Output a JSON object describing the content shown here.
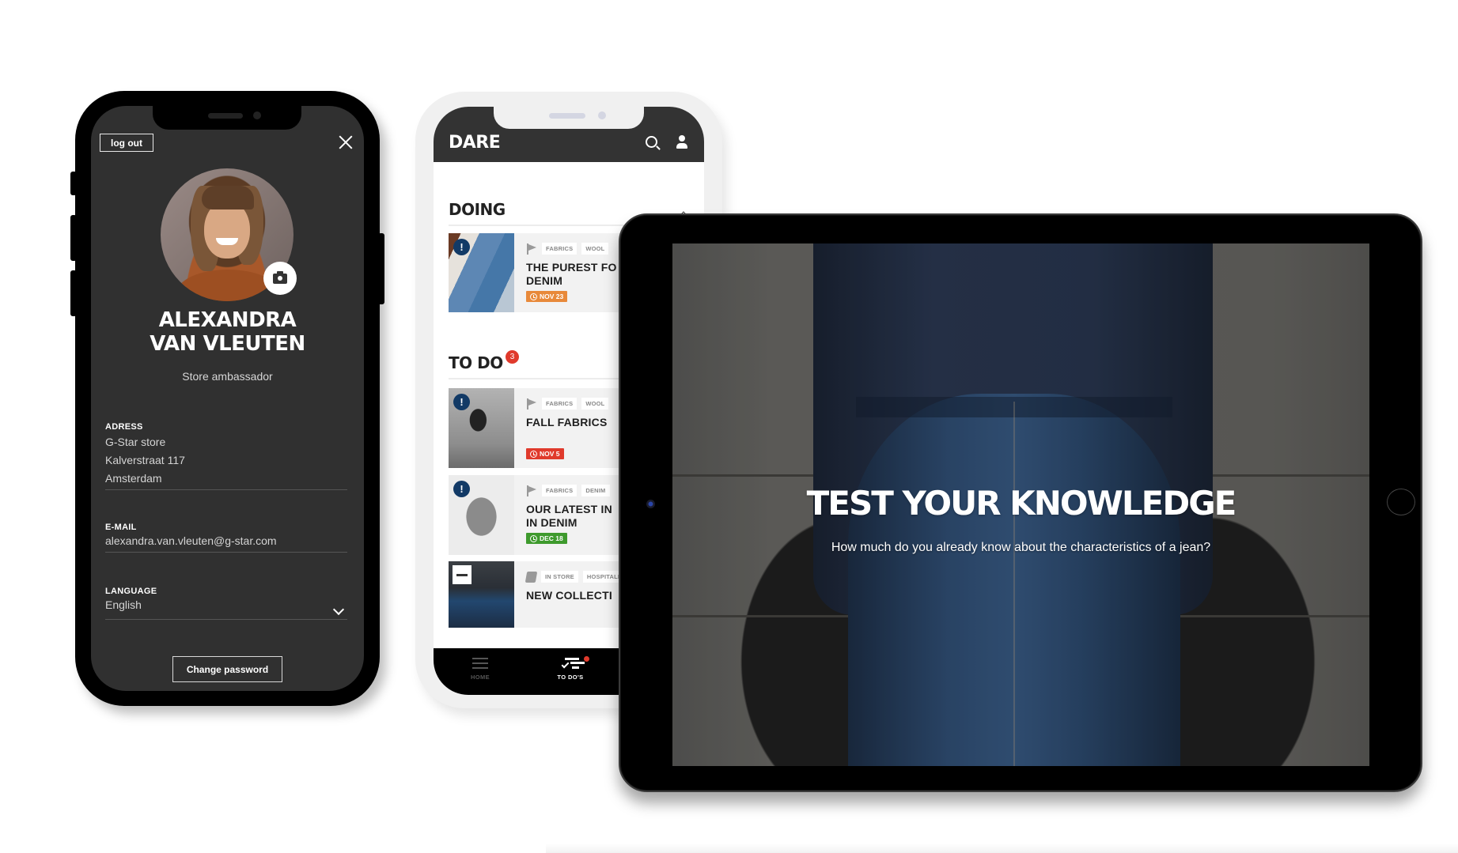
{
  "profile_phone": {
    "logout_label": "log out",
    "name_line1": "ALEXANDRA",
    "name_line2": "VAN VLEUTEN",
    "role": "Store ambassador",
    "fields": {
      "address": {
        "label": "ADRESS",
        "lines": [
          "G-Star store",
          "Kalverstraat 117",
          "Amsterdam"
        ]
      },
      "email": {
        "label": "E-MAIL",
        "value": "alexandra.van.vleuten@g-star.com"
      },
      "language": {
        "label": "LANGUAGE",
        "value": "English"
      }
    },
    "change_password_label": "Change password"
  },
  "todo_phone": {
    "app_name": "DARE",
    "sections": {
      "doing": {
        "title": "DOING"
      },
      "todo": {
        "title": "TO DO",
        "count": "3"
      }
    },
    "cards": [
      {
        "tags": [
          "FABRICS",
          "WOOL"
        ],
        "title_line1": "THE PUREST FO",
        "title_line2": "DENIM",
        "due": "NOV 23",
        "due_color": "#e8893a",
        "badge": "!"
      },
      {
        "tags": [
          "FABRICS",
          "WOOL"
        ],
        "title_line1": "FALL FABRICS",
        "title_line2": "",
        "due": "NOV 5",
        "due_color": "#e03a2c",
        "badge": "!"
      },
      {
        "tags": [
          "FABRICS",
          "DENIM"
        ],
        "title_line1": "OUR LATEST IN",
        "title_line2": "IN DENIM",
        "due": "DEC 18",
        "due_color": "#3e9a2d",
        "badge": "!"
      },
      {
        "tags": [
          "IN STORE",
          "HOSPITALIT"
        ],
        "title_line1": "NEW COLLECTI",
        "title_line2": "",
        "due": "",
        "badge": "-"
      }
    ],
    "tabbar": {
      "home_label": "HOME",
      "todos_label": "TO DO'S"
    }
  },
  "tablet": {
    "hero_title": "TEST YOUR KNOWLEDGE",
    "hero_subtitle": "How much do you already know about the characteristics of a jean?"
  },
  "colors": {
    "profile_bg": "#303030",
    "header_bg": "#333333",
    "alert_badge": "#123a66",
    "notification_red": "#e03a2c"
  }
}
